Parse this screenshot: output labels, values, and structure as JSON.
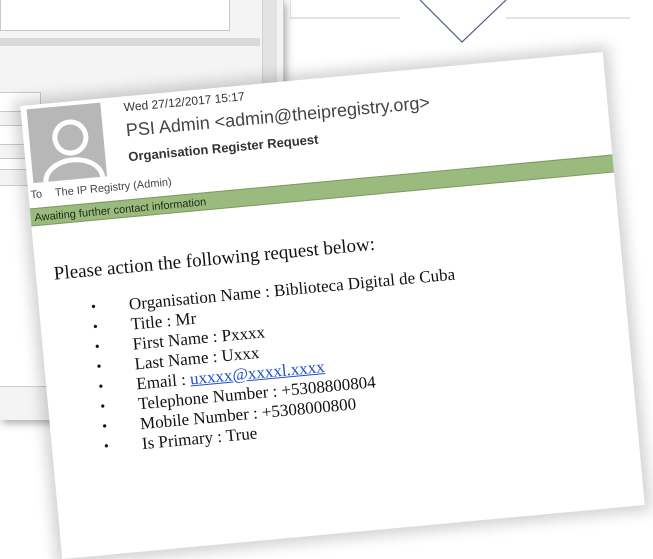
{
  "email": {
    "date": "Wed 27/12/2017 15:17",
    "from": "PSI Admin <admin@theipregistry.org>",
    "subject": "Organisation Register Request",
    "to_label": "To",
    "to_value": "The IP Registry (Admin)",
    "banner": "Awaiting further contact information",
    "intro": "Please action the following request below:",
    "details": [
      {
        "label": "Organisation Name : ",
        "value": "Biblioteca Digital de Cuba"
      },
      {
        "label": "Title : ",
        "value": "Mr"
      },
      {
        "label": "First Name : ",
        "value": "Pxxxx"
      },
      {
        "label": "Last Name : ",
        "value": "Uxxx"
      },
      {
        "label": "Email : ",
        "value": "uxxxx@xxxxl.xxxx"
      },
      {
        "label": "Telephone Number : ",
        "value": "+5308800804"
      },
      {
        "label": "Mobile Number : ",
        "value": "+5308000800"
      },
      {
        "label": "Is Primary : ",
        "value": "True"
      }
    ],
    "bullet": "•"
  },
  "colors": {
    "banner": "#9bbb7e",
    "link": "#1f4fd1",
    "avatar": "#b7b7b7"
  },
  "icons": {
    "avatar": "person-silhouette-icon",
    "pointer": "callout-pointer-icon"
  }
}
